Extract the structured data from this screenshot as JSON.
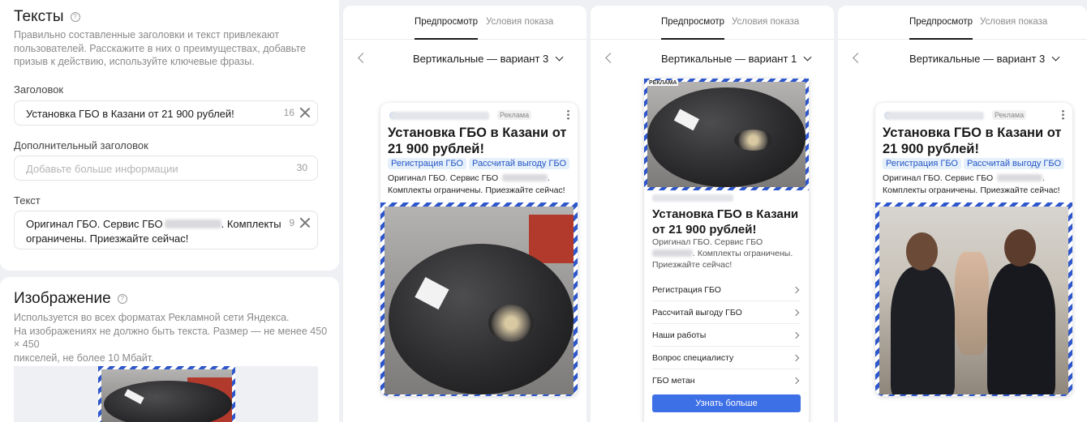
{
  "editor": {
    "texts_title": "Тексты",
    "texts_desc": "Правильно составленные заголовки и текст привлекают пользователей. Расскажите в них о преимуществах, добавьте призыв к действию, используйте ключевые фразы.",
    "headline_label": "Заголовок",
    "headline_value": "Установка ГБО в Казани от 21 900 рублей!",
    "headline_count": "16",
    "extra_label": "Дополнительный заголовок",
    "extra_placeholder": "Добавьте больше информации",
    "extra_count": "30",
    "text_label": "Текст",
    "text_value_1": "Оригинал ГБО. Сервис ГБО",
    "text_value_2": ". Комплекты",
    "text_value_3": "ограничены. Приезжайте сейчас!",
    "text_count": "9",
    "image_title": "Изображение",
    "image_desc_1": "Используется во всех форматах Рекламной сети Яндекса.",
    "image_desc_2": "На изображениях не должно быть текста. Размер — не менее 450 × 450",
    "image_desc_3": "пикселей, не более 10 Мбайт."
  },
  "preview": {
    "tab_preview": "Предпросмотр",
    "tab_conditions": "Условия показа",
    "panels": [
      {
        "variant": "Вертикальные — вариант 3"
      },
      {
        "variant": "Вертикальные — вариант 1"
      },
      {
        "variant": "Вертикальные — вариант 3"
      }
    ],
    "ad": {
      "label": "Реклама",
      "title": "Установка ГБО в Казани от 21 900 рублей!",
      "link1": "Регистрация ГБО",
      "link2": "Рассчитай выгоду ГБО",
      "body_1": "Оригинал ГБО. Сервис ГБО",
      "body_2": ".",
      "body_3": "Комплекты ограничены. Приезжайте сейчас!"
    },
    "ad1": {
      "label": "РЕКЛАМА",
      "title": "Установка ГБО в Казани от 21 900 рублей!",
      "body_1": "Оригинал ГБО. Сервис ГБО",
      "body_2": ". Комплекты ограничены.",
      "body_3": "Приезжайте сейчас!",
      "rows": [
        "Регистрация ГБО",
        "Рассчитай выгоду ГБО",
        "Наши работы",
        "Вопрос специалисту",
        "ГБО метан"
      ],
      "cta": "Узнать больше"
    }
  },
  "colors": {
    "accent": "#3d6fe6",
    "link": "#2356c4",
    "stripe": "#2f57cc"
  }
}
